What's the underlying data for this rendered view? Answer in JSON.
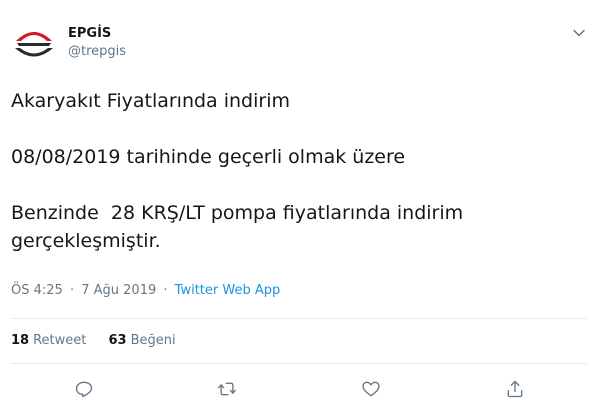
{
  "account": {
    "name": "EPGİS",
    "handle": "@trepgis"
  },
  "tweet": {
    "lines": [
      "Akaryakıt Fiyatlarında indirim",
      "08/08/2019 tarihinde geçerli olmak üzere",
      "Benzinde  28 KRŞ/LT pompa fiyatlarında indirim",
      "gerçekleşmiştir."
    ],
    "time": "ÖS 4:25",
    "date": "7 Ağu 2019",
    "separator": "·",
    "source": "Twitter Web App"
  },
  "stats": {
    "retweets_count": "18",
    "retweets_label": "Retweet",
    "likes_count": "63",
    "likes_label": "Beğeni"
  },
  "icons": {
    "caret": "chevron-down-icon",
    "reply": "reply-icon",
    "retweet": "retweet-icon",
    "like": "heart-icon",
    "share": "share-icon"
  },
  "colors": {
    "text": "#14171a",
    "secondary": "#657786",
    "link": "#1b95e0",
    "divider": "#e6ecf0",
    "logo_red": "#d71920",
    "logo_dark": "#2b2b2b"
  }
}
